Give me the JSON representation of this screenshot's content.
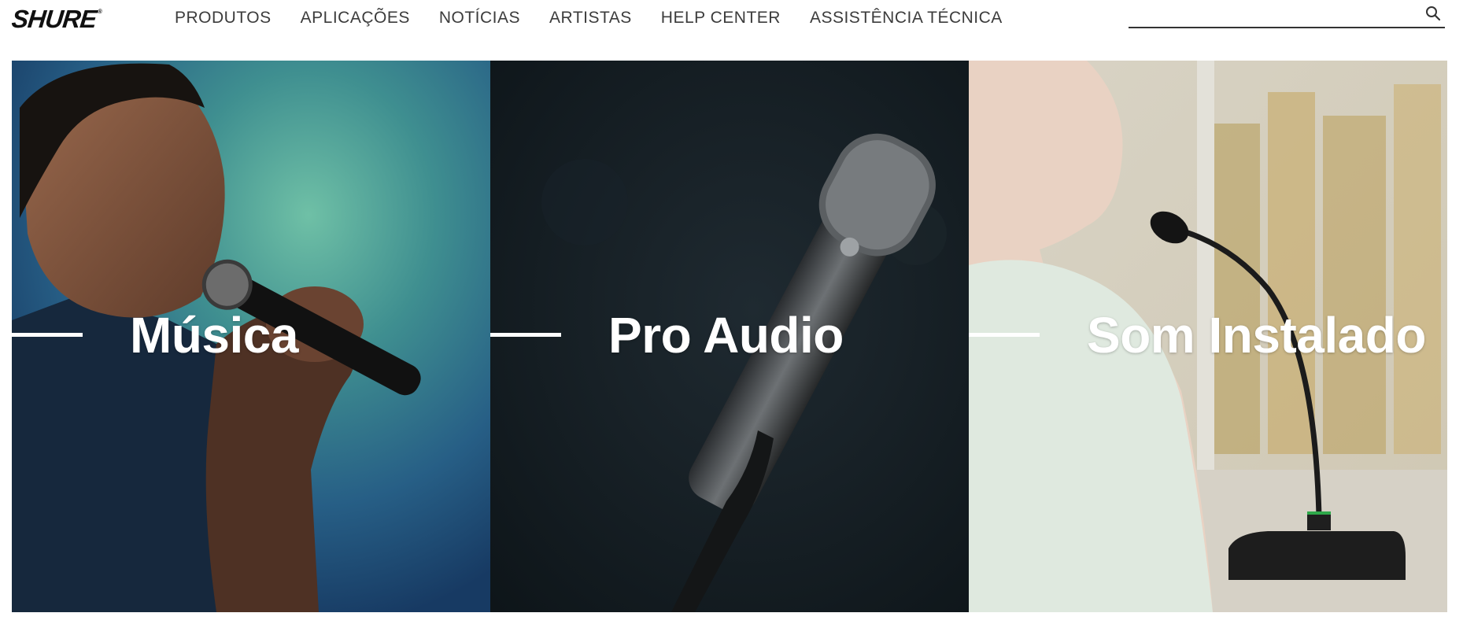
{
  "header": {
    "logo_text": "SHURE",
    "logo_mark": "®",
    "nav": [
      {
        "label": "PRODUTOS"
      },
      {
        "label": "APLICAÇÕES"
      },
      {
        "label": "NOTÍCIAS"
      },
      {
        "label": "ARTISTAS"
      },
      {
        "label": "HELP CENTER"
      },
      {
        "label": "ASSISTÊNCIA TÉCNICA"
      }
    ],
    "search": {
      "value": "",
      "placeholder": "",
      "icon": "search-icon"
    }
  },
  "panels": [
    {
      "label": "Música",
      "image": "singer-with-microphone"
    },
    {
      "label": "Pro Audio",
      "image": "handheld-microphone-on-stand"
    },
    {
      "label": "Som Instalado",
      "image": "woman-with-gooseneck-microphone"
    }
  ],
  "colors": {
    "nav_text": "#3c3c3c",
    "logo": "#111111",
    "label_text": "#ffffff"
  }
}
